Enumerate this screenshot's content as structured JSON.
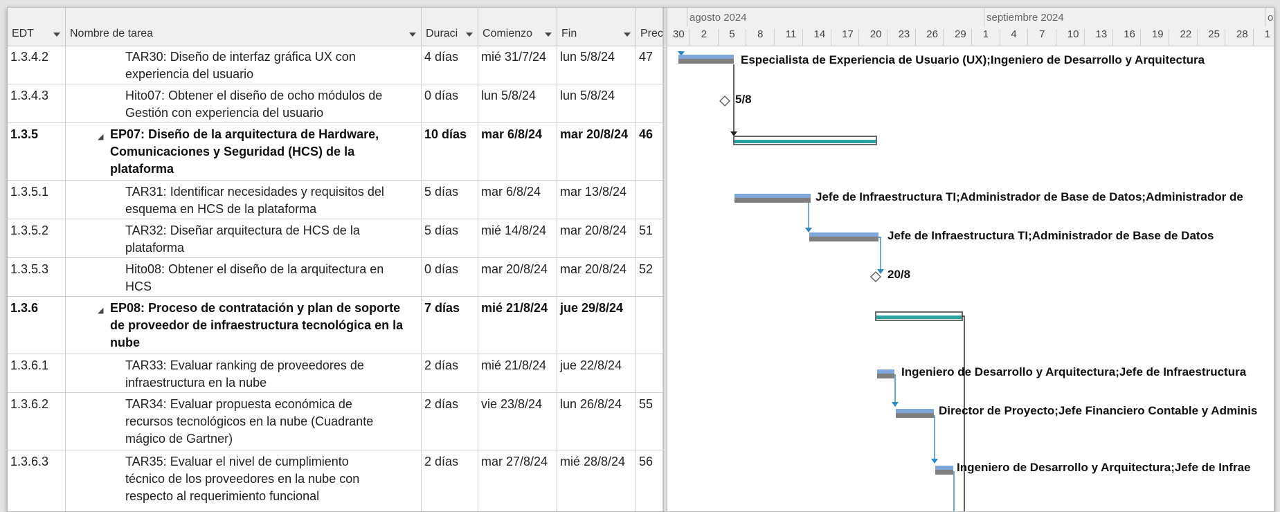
{
  "columns": {
    "edt": "EDT",
    "name": "Nombre de tarea",
    "duration": "Duraci",
    "start": "Comienzo",
    "end": "Fin",
    "pred": "Prec"
  },
  "rows": [
    {
      "edt": "1.3.4.2",
      "lines": [
        "TAR30: Diseño de interfaz gráfica UX con",
        "experiencia del usuario"
      ],
      "dur": "4 días",
      "start": "mié 31/7/24",
      "end": "lun 5/8/24",
      "pred": "47"
    },
    {
      "edt": "1.3.4.3",
      "lines": [
        "Hito07: Obtener el diseño de ocho módulos de",
        "Gestión con experiencia del usuario"
      ],
      "dur": "0 días",
      "start": "lun 5/8/24",
      "end": "lun 5/8/24",
      "pred": ""
    },
    {
      "edt": "1.3.5",
      "lines": [
        "EP07: Diseño de la arquitectura de Hardware,",
        "Comunicaciones y Seguridad (HCS) de la",
        "plataforma"
      ],
      "dur": "10 días",
      "start": "mar 6/8/24",
      "end": "mar 20/8/24",
      "pred": "46"
    },
    {
      "edt": "1.3.5.1",
      "lines": [
        "TAR31: Identificar necesidades y requisitos del",
        "esquema en HCS de la plataforma"
      ],
      "dur": "5 días",
      "start": "mar 6/8/24",
      "end": "mar 13/8/24",
      "pred": ""
    },
    {
      "edt": "1.3.5.2",
      "lines": [
        "TAR32: Diseñar arquitectura de HCS de la",
        "plataforma"
      ],
      "dur": "5 días",
      "start": "mié 14/8/24",
      "end": "mar 20/8/24",
      "pred": "51"
    },
    {
      "edt": "1.3.5.3",
      "lines": [
        "Hito08: Obtener el diseño de la arquitectura en",
        "HCS"
      ],
      "dur": "0 días",
      "start": "mar 20/8/24",
      "end": "mar 20/8/24",
      "pred": "52"
    },
    {
      "edt": "1.3.6",
      "lines": [
        "EP08: Proceso de contratación y plan de soporte",
        "de proveedor de infraestructura tecnológica en la",
        "nube"
      ],
      "dur": "7 días",
      "start": "mié 21/8/24",
      "end": "jue 29/8/24",
      "pred": ""
    },
    {
      "edt": "1.3.6.1",
      "lines": [
        "TAR33: Evaluar ranking de proveedores de",
        "infraestructura en la nube"
      ],
      "dur": "2 días",
      "start": "mié 21/8/24",
      "end": "jue 22/8/24",
      "pred": ""
    },
    {
      "edt": "1.3.6.2",
      "lines": [
        "TAR34: Evaluar propuesta económica de",
        "recursos tecnológicos en la nube (Cuadrante",
        "mágico de Gartner)"
      ],
      "dur": "2 días",
      "start": "vie 23/8/24",
      "end": "lun 26/8/24",
      "pred": "55"
    },
    {
      "edt": "1.3.6.3",
      "lines": [
        "TAR35: Evaluar el nivel de cumplimiento",
        "técnico de los proveedores en la nube con",
        "respecto al requerimiento funcional"
      ],
      "dur": "2 días",
      "start": "mar 27/8/24",
      "end": "mié 28/8/24",
      "pred": "56"
    }
  ],
  "timeline": {
    "months": [
      "agosto 2024",
      "septiembre 2024",
      "oc"
    ],
    "days": [
      "30",
      "2",
      "5",
      "8",
      "11",
      "14",
      "17",
      "20",
      "23",
      "26",
      "29",
      "1",
      "4",
      "7",
      "10",
      "13",
      "16",
      "19",
      "22",
      "25",
      "28",
      "1"
    ]
  },
  "gantt_labels": {
    "r0": "Especialista de Experiencia de Usuario (UX);Ingeniero de Desarrollo y Arquitectura",
    "r1": "5/8",
    "r3": "Jefe de Infraestructura TI;Administrador de Base de Datos;Administrador de",
    "r4": "Jefe de Infraestructura TI;Administrador de Base de Datos",
    "r5": "20/8",
    "r7": "Ingeniero de Desarrollo y Arquitectura;Jefe de Infraestructura",
    "r8": "Director de Proyecto;Jefe Financiero Contable y Adminis",
    "r9": "Ingeniero de Desarrollo y Arquitectura;Jefe de Infrae"
  },
  "colors": {
    "task_bar": "#7fa7d9",
    "baseline_bar": "#7f7f7f",
    "summary_fill": "#2aa3a3",
    "link_arrow": "#2b88c9"
  }
}
